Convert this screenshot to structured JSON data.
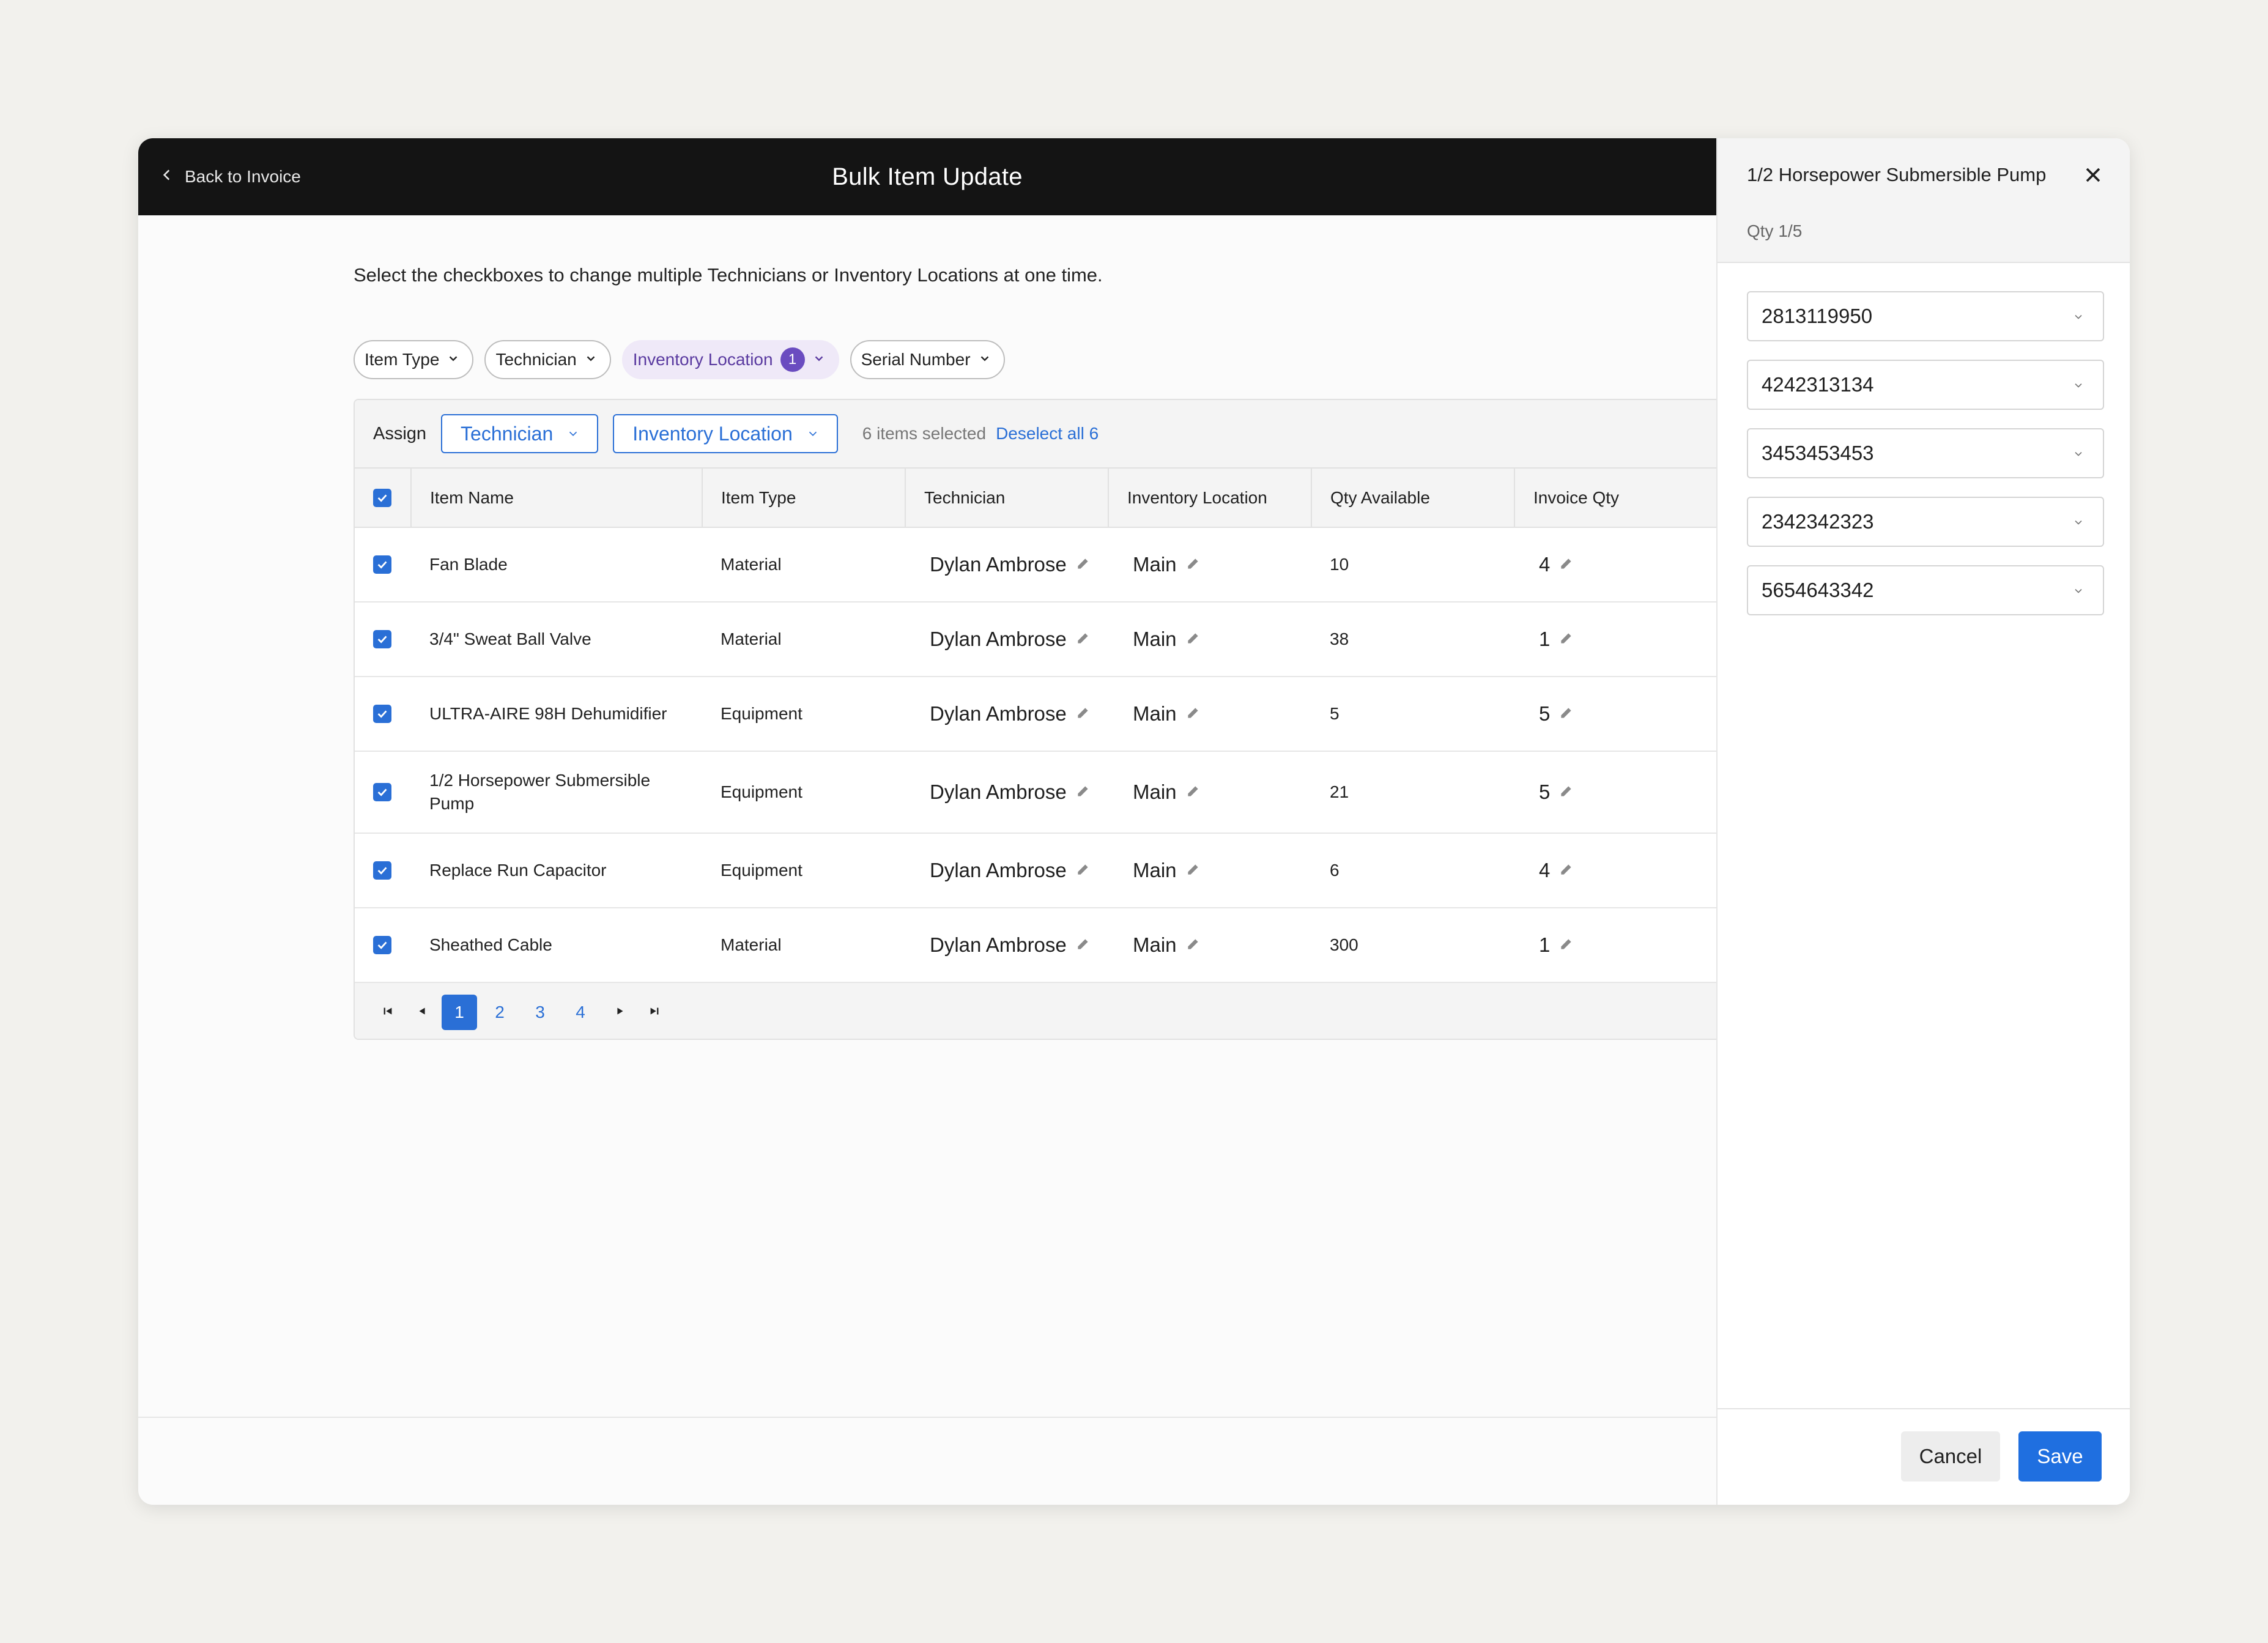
{
  "header": {
    "back_label": "Back to Invoice",
    "title": "Bulk Item Update"
  },
  "instructions": "Select the checkboxes to change multiple Technicians or Inventory Locations at one time.",
  "filters": [
    {
      "label": "Item Type"
    },
    {
      "label": "Technician"
    },
    {
      "label": "Inventory Location",
      "badge": "1"
    },
    {
      "label": "Serial Number"
    }
  ],
  "assign_bar": {
    "label": "Assign",
    "technician_button": "Technician",
    "location_button": "Inventory Location",
    "selected_text": "6 items selected",
    "deselect_text": "Deselect all 6"
  },
  "table": {
    "columns": [
      "Item Name",
      "Item Type",
      "Technician",
      "Inventory Location",
      "Qty Available",
      "Invoice Qty"
    ],
    "rows": [
      {
        "name": "Fan Blade",
        "type": "Material",
        "technician": "Dylan Ambrose",
        "location": "Main",
        "qty_available": "10",
        "invoice_qty": "4"
      },
      {
        "name": "3/4\" Sweat Ball Valve",
        "type": "Material",
        "technician": "Dylan Ambrose",
        "location": "Main",
        "qty_available": "38",
        "invoice_qty": "1"
      },
      {
        "name": "ULTRA-AIRE 98H Dehumidifier",
        "type": "Equipment",
        "technician": "Dylan Ambrose",
        "location": "Main",
        "qty_available": "5",
        "invoice_qty": "5"
      },
      {
        "name": "1/2 Horsepower Submersible Pump",
        "type": "Equipment",
        "technician": "Dylan Ambrose",
        "location": "Main",
        "qty_available": "21",
        "invoice_qty": "5"
      },
      {
        "name": "Replace Run Capacitor",
        "type": "Equipment",
        "technician": "Dylan Ambrose",
        "location": "Main",
        "qty_available": "6",
        "invoice_qty": "4"
      },
      {
        "name": "Sheathed Cable",
        "type": "Material",
        "technician": "Dylan Ambrose",
        "location": "Main",
        "qty_available": "300",
        "invoice_qty": "1"
      }
    ]
  },
  "pagination": {
    "pages": [
      "1",
      "2",
      "3",
      "4"
    ],
    "current": "1"
  },
  "panel": {
    "title": "1/2 Horsepower Submersible Pump",
    "qty_label": "Qty 1/5",
    "serials": [
      "2813119950",
      "4242313134",
      "3453453453",
      "2342342323",
      "5654643342"
    ],
    "cancel_label": "Cancel",
    "save_label": "Save"
  },
  "colors": {
    "accent": "#2a6fd6",
    "topbar": "#141414",
    "filter_active_bg": "#efe9f8",
    "filter_badge": "#6a4cc0"
  }
}
